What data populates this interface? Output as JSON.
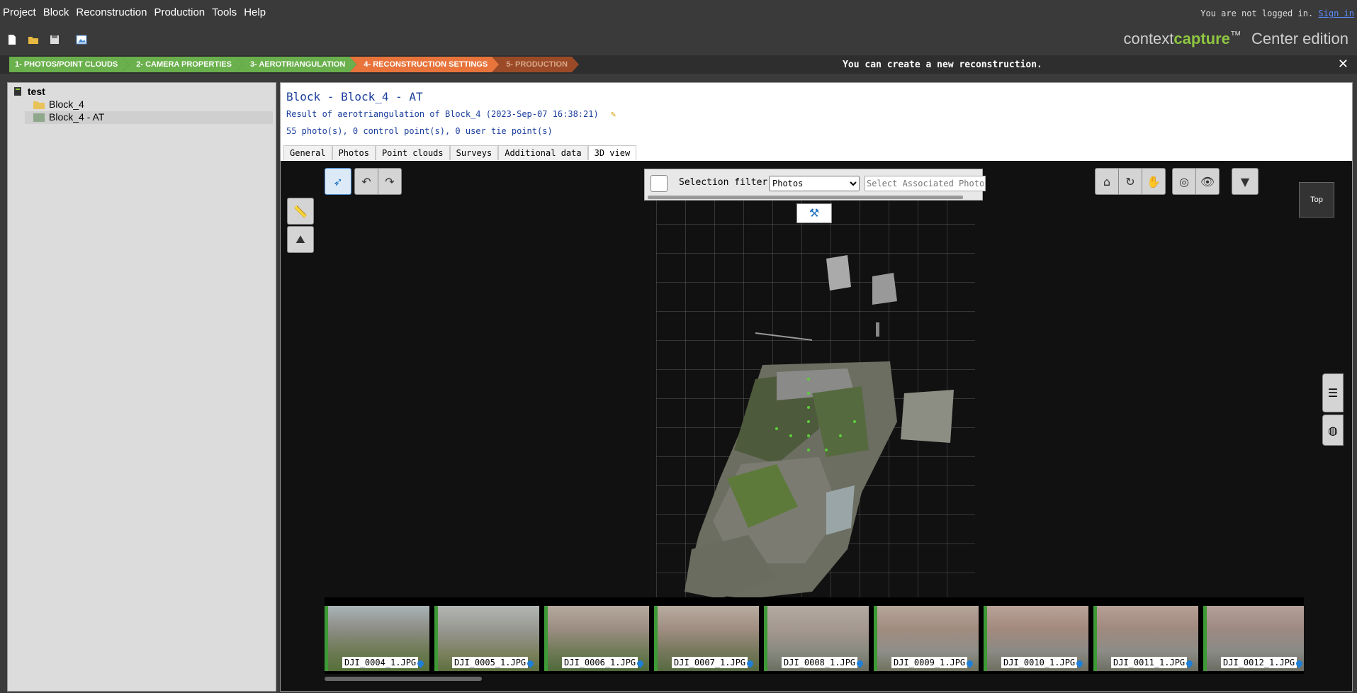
{
  "menu": {
    "items": [
      "Project",
      "Block",
      "Reconstruction",
      "Production",
      "Tools",
      "Help"
    ],
    "login_text": "You are not logged in.",
    "sign_in": "Sign in"
  },
  "brand": {
    "name_light": "context",
    "name_bold": "capture",
    "tm": "™",
    "edition": "Center edition"
  },
  "wizard": {
    "steps": [
      {
        "label": "1- PHOTOS/POINT CLOUDS",
        "color": "#6ab04c"
      },
      {
        "label": "2- CAMERA PROPERTIES",
        "color": "#6ab04c"
      },
      {
        "label": "3- AEROTRIANGULATION",
        "color": "#6ab04c"
      },
      {
        "label": "4- RECONSTRUCTION SETTINGS",
        "color": "#e8743b"
      },
      {
        "label": "5- PRODUCTION",
        "color": "#9b4a28"
      }
    ],
    "message": "You can create a new reconstruction.",
    "close": "✕"
  },
  "tree": {
    "root": "test",
    "items": [
      {
        "label": "Block_4",
        "selected": false,
        "icon": "folder-icon"
      },
      {
        "label": "Block_4 - AT",
        "selected": true,
        "icon": "block-icon"
      }
    ]
  },
  "header": {
    "title": "Block - Block_4 - AT",
    "subtitle": "Result of aerotriangulation of Block_4 (2023-Sep-07 16:38:21)",
    "info": "55 photo(s), 0 control point(s), 0 user tie point(s)"
  },
  "tabs": [
    "General",
    "Photos",
    "Point clouds",
    "Surveys",
    "Additional data",
    "3D view"
  ],
  "filter": {
    "label": "Selection filter:",
    "value": "Photos",
    "placeholder": "Select Associated Photos"
  },
  "view": {
    "top_label": "Top"
  },
  "thumbnails": [
    "DJI_0004_1.JPG",
    "DJI_0005_1.JPG",
    "DJI_0006_1.JPG",
    "DJI_0007_1.JPG",
    "DJI_0008_1.JPG",
    "DJI_0009_1.JPG",
    "DJI_0010_1.JPG",
    "DJI_0011_1.JPG",
    "DJI_0012_1.JPG"
  ]
}
